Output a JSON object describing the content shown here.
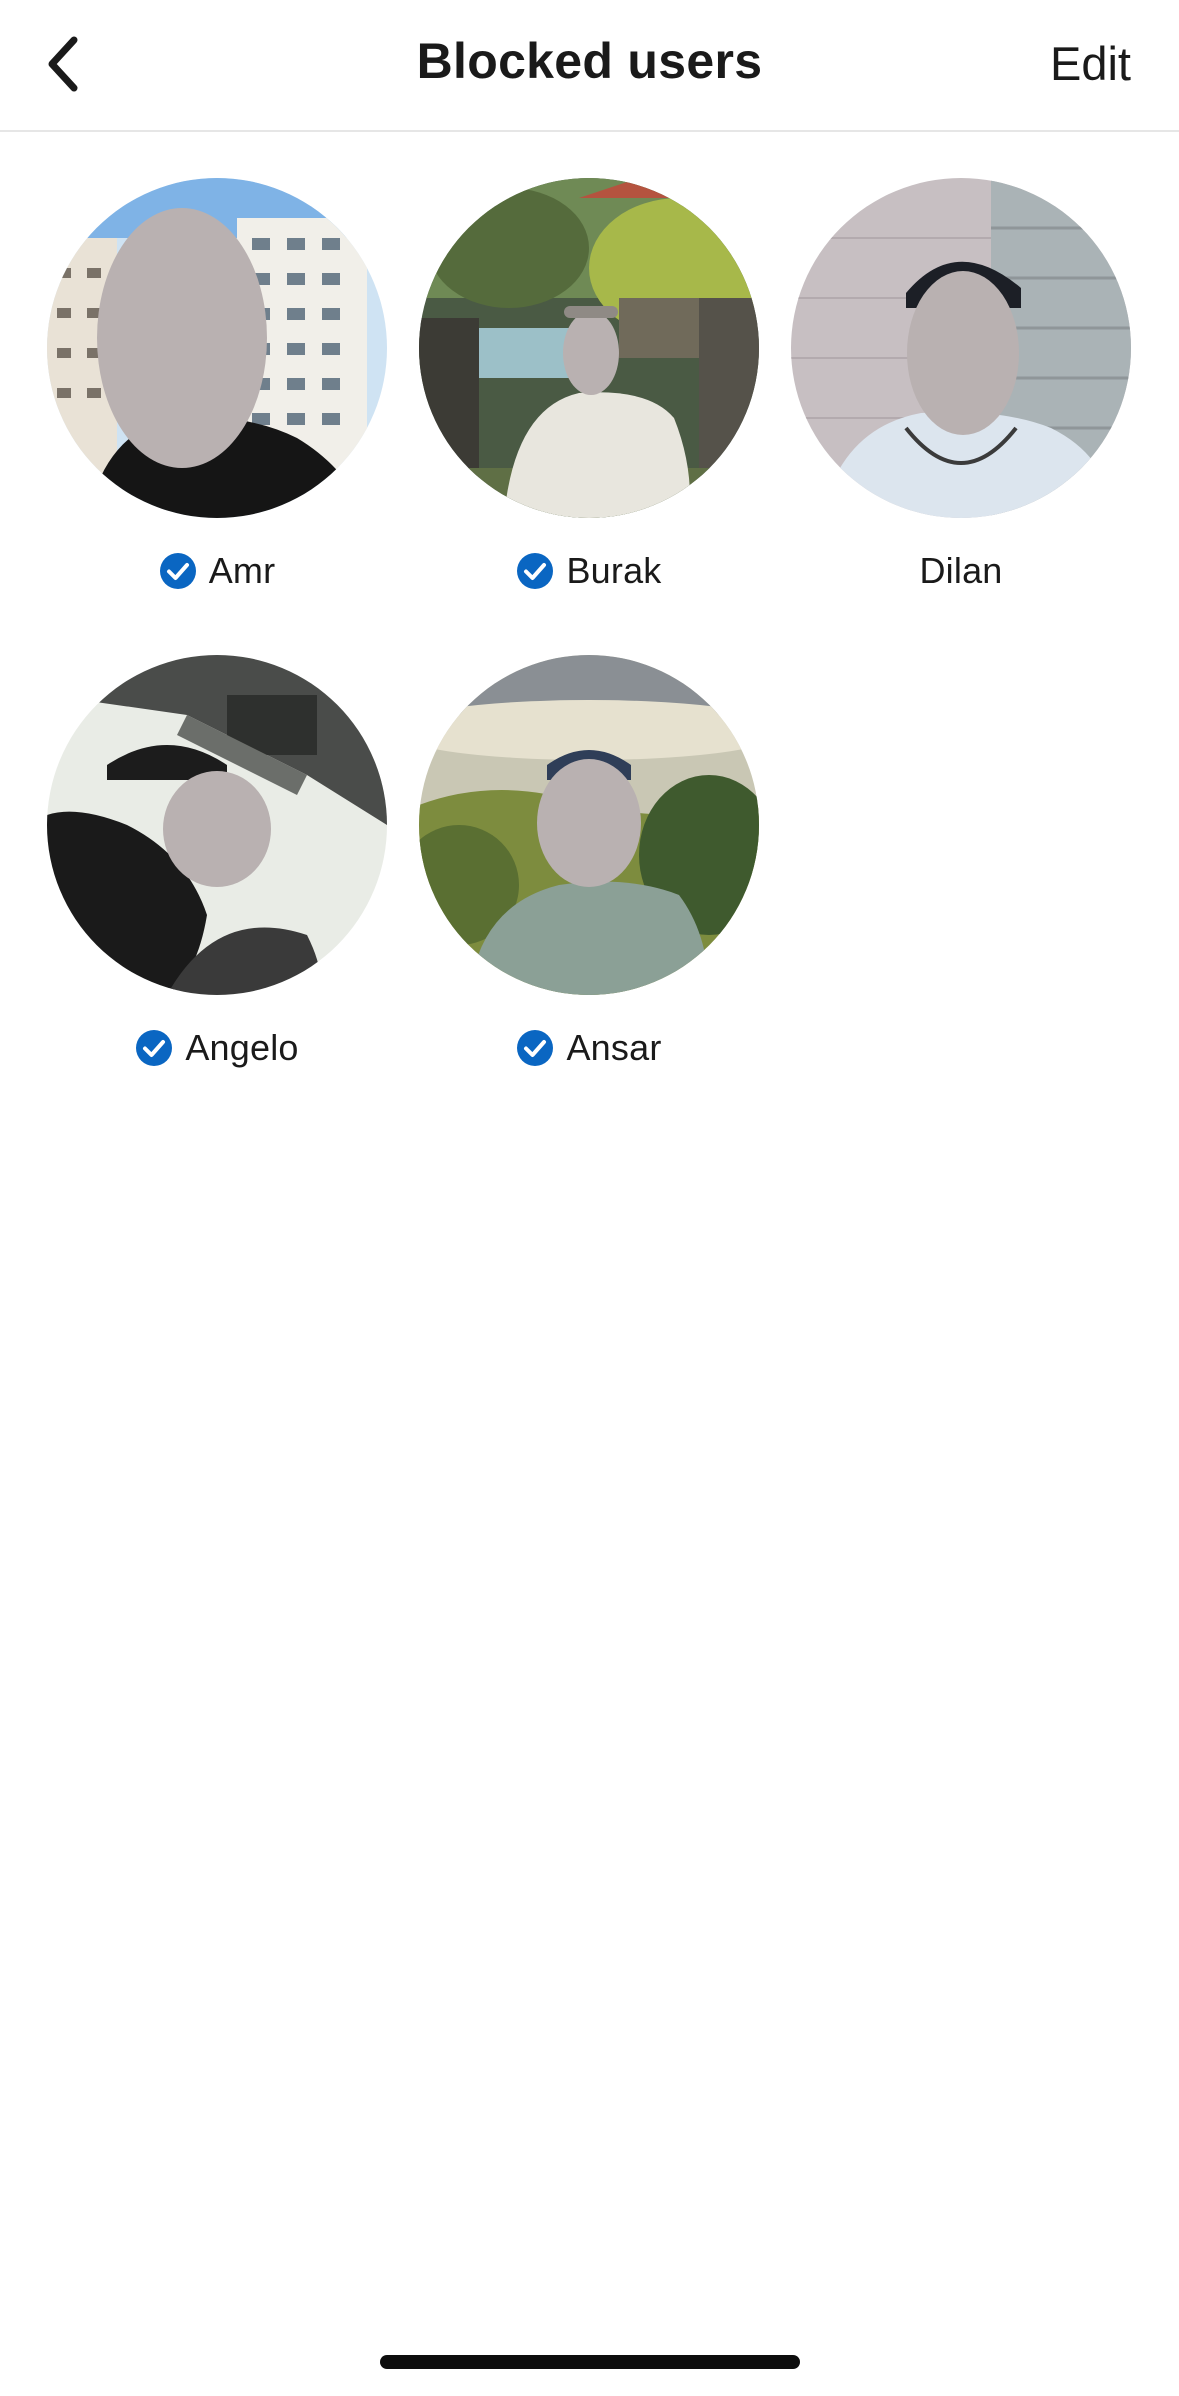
{
  "header": {
    "title": "Blocked users",
    "edit_label": "Edit",
    "back_icon": "chevron-left-icon"
  },
  "users": [
    {
      "name": "Amr",
      "verified": true
    },
    {
      "name": "Burak",
      "verified": true
    },
    {
      "name": "Dilan",
      "verified": false
    },
    {
      "name": "Angelo",
      "verified": true
    },
    {
      "name": "Ansar",
      "verified": true
    }
  ],
  "colors": {
    "verified_badge": "#0a66c2",
    "face_blur": "#b9b1b1",
    "divider": "#e6e6e6",
    "text": "#1a1a1a"
  }
}
